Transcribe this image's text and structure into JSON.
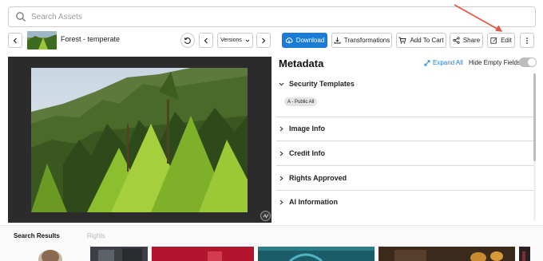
{
  "search": {
    "placeholder": "Search Assets"
  },
  "asset": {
    "title": "Forest - temperate"
  },
  "toolbar": {
    "versions_label": "Versions",
    "download_label": "Download",
    "transformations_label": "Transformations",
    "add_to_cart_label": "Add To Cart",
    "share_label": "Share",
    "edit_label": "Edit"
  },
  "metadata": {
    "title": "Metadata",
    "expand_all": "Expand All",
    "hide_empty": "Hide Empty Fields",
    "hide_empty_on": false,
    "sections": [
      {
        "label": "Security Templates",
        "expanded": true
      },
      {
        "label": "Image Info",
        "expanded": false
      },
      {
        "label": "Credit Info",
        "expanded": false
      },
      {
        "label": "Rights Approved",
        "expanded": false
      },
      {
        "label": "AI Information",
        "expanded": false
      }
    ],
    "security_chip": "A - Public All"
  },
  "tabs": [
    {
      "label": "Search Results",
      "active": true
    },
    {
      "label": "Rights",
      "active": false
    }
  ],
  "colors": {
    "accent": "#1b7cd6",
    "arrow": "#e8553f"
  }
}
